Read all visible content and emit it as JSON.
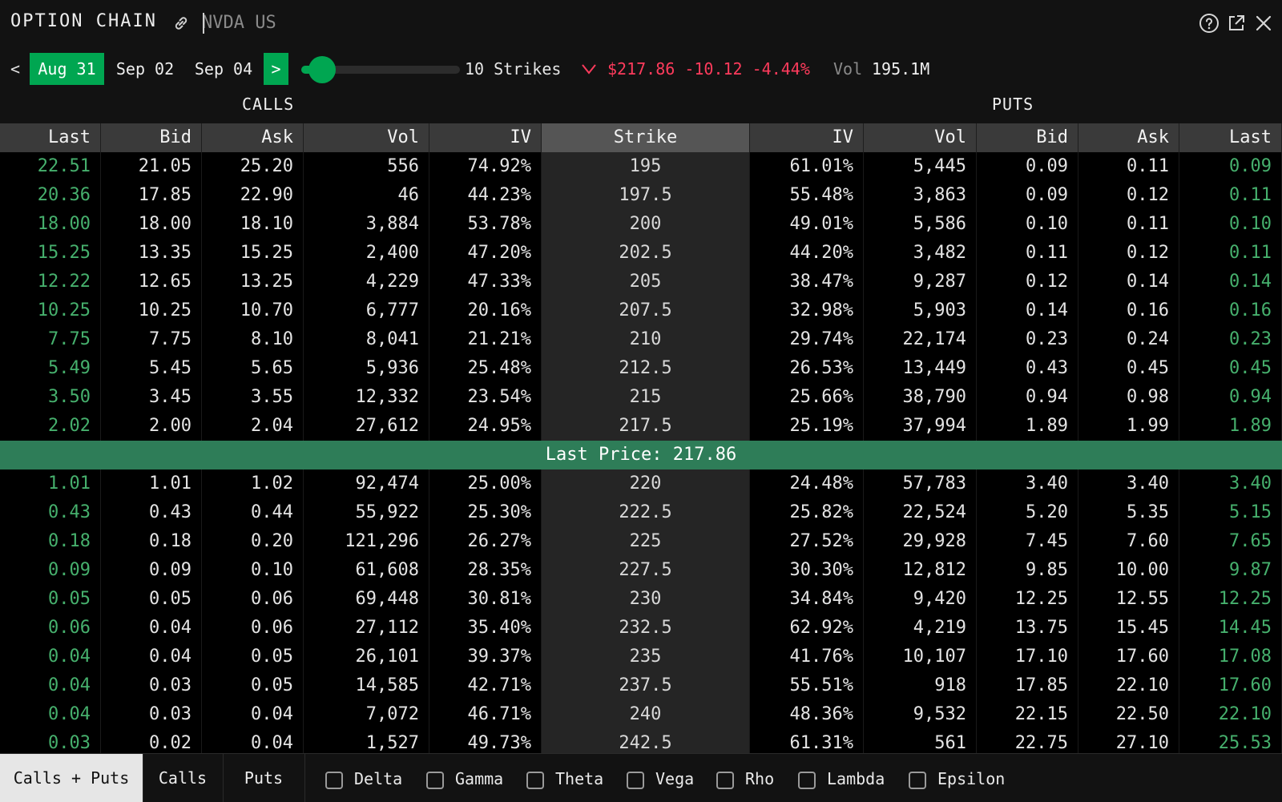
{
  "header": {
    "title": "OPTION CHAIN",
    "ticker_placeholder": "NVDA US"
  },
  "toolbar": {
    "prev": "<",
    "next": ">",
    "dates": [
      {
        "label": "Aug 31",
        "active": true
      },
      {
        "label": "Sep 02",
        "active": false
      },
      {
        "label": "Sep 04",
        "active": false
      }
    ],
    "slider_fraction": 0.08,
    "strikes_label": "10 Strikes",
    "price_line": "$217.86 -10.12 -4.44%",
    "vol_label": "Vol",
    "vol_value": "195.1M",
    "down_color": "#ff3b5c",
    "accent": "#00a651"
  },
  "sections": {
    "calls": "CALLS",
    "puts": "PUTS"
  },
  "columns": [
    "Last",
    "Bid",
    "Ask",
    "Vol",
    "IV",
    "Strike",
    "IV",
    "Vol",
    "Bid",
    "Ask",
    "Last"
  ],
  "rows_above": [
    [
      "22.51",
      "21.05",
      "25.20",
      "556",
      "74.92%",
      "195",
      "61.01%",
      "5,445",
      "0.09",
      "0.11",
      "0.09"
    ],
    [
      "20.36",
      "17.85",
      "22.90",
      "46",
      "44.23%",
      "197.5",
      "55.48%",
      "3,863",
      "0.09",
      "0.12",
      "0.11"
    ],
    [
      "18.00",
      "18.00",
      "18.10",
      "3,884",
      "53.78%",
      "200",
      "49.01%",
      "5,586",
      "0.10",
      "0.11",
      "0.10"
    ],
    [
      "15.25",
      "13.35",
      "15.25",
      "2,400",
      "47.20%",
      "202.5",
      "44.20%",
      "3,482",
      "0.11",
      "0.12",
      "0.11"
    ],
    [
      "12.22",
      "12.65",
      "13.25",
      "4,229",
      "47.33%",
      "205",
      "38.47%",
      "9,287",
      "0.12",
      "0.14",
      "0.14"
    ],
    [
      "10.25",
      "10.25",
      "10.70",
      "6,777",
      "20.16%",
      "207.5",
      "32.98%",
      "5,903",
      "0.14",
      "0.16",
      "0.16"
    ],
    [
      "7.75",
      "7.75",
      "8.10",
      "8,041",
      "21.21%",
      "210",
      "29.74%",
      "22,174",
      "0.23",
      "0.24",
      "0.23"
    ],
    [
      "5.49",
      "5.45",
      "5.65",
      "5,936",
      "25.48%",
      "212.5",
      "26.53%",
      "13,449",
      "0.43",
      "0.45",
      "0.45"
    ],
    [
      "3.50",
      "3.45",
      "3.55",
      "12,332",
      "23.54%",
      "215",
      "25.66%",
      "38,790",
      "0.94",
      "0.98",
      "0.94"
    ],
    [
      "2.02",
      "2.00",
      "2.04",
      "27,612",
      "24.95%",
      "217.5",
      "25.19%",
      "37,994",
      "1.89",
      "1.99",
      "1.89"
    ]
  ],
  "last_price_label": "Last Price: 217.86",
  "rows_below": [
    [
      "1.01",
      "1.01",
      "1.02",
      "92,474",
      "25.00%",
      "220",
      "24.48%",
      "57,783",
      "3.40",
      "3.40",
      "3.40"
    ],
    [
      "0.43",
      "0.43",
      "0.44",
      "55,922",
      "25.30%",
      "222.5",
      "25.82%",
      "22,524",
      "5.20",
      "5.35",
      "5.15"
    ],
    [
      "0.18",
      "0.18",
      "0.20",
      "121,296",
      "26.27%",
      "225",
      "27.52%",
      "29,928",
      "7.45",
      "7.60",
      "7.65"
    ],
    [
      "0.09",
      "0.09",
      "0.10",
      "61,608",
      "28.35%",
      "227.5",
      "30.30%",
      "12,812",
      "9.85",
      "10.00",
      "9.87"
    ],
    [
      "0.05",
      "0.05",
      "0.06",
      "69,448",
      "30.81%",
      "230",
      "34.84%",
      "9,420",
      "12.25",
      "12.55",
      "12.25"
    ],
    [
      "0.06",
      "0.04",
      "0.06",
      "27,112",
      "35.40%",
      "232.5",
      "62.92%",
      "4,219",
      "13.75",
      "15.45",
      "14.45"
    ],
    [
      "0.04",
      "0.04",
      "0.05",
      "26,101",
      "39.37%",
      "235",
      "41.76%",
      "10,107",
      "17.10",
      "17.60",
      "17.08"
    ],
    [
      "0.04",
      "0.03",
      "0.05",
      "14,585",
      "42.71%",
      "237.5",
      "55.51%",
      "918",
      "17.85",
      "22.10",
      "17.60"
    ],
    [
      "0.04",
      "0.03",
      "0.04",
      "7,072",
      "46.71%",
      "240",
      "48.36%",
      "9,532",
      "22.15",
      "22.50",
      "22.10"
    ],
    [
      "0.03",
      "0.02",
      "0.04",
      "1,527",
      "49.73%",
      "242.5",
      "61.31%",
      "561",
      "22.75",
      "27.10",
      "25.53"
    ]
  ],
  "footer": {
    "tabs": [
      {
        "label": "Calls + Puts",
        "active": true
      },
      {
        "label": "Calls",
        "active": false
      },
      {
        "label": "Puts",
        "active": false
      }
    ],
    "checkboxes": [
      "Delta",
      "Gamma",
      "Theta",
      "Vega",
      "Rho",
      "Lambda",
      "Epsilon"
    ]
  }
}
